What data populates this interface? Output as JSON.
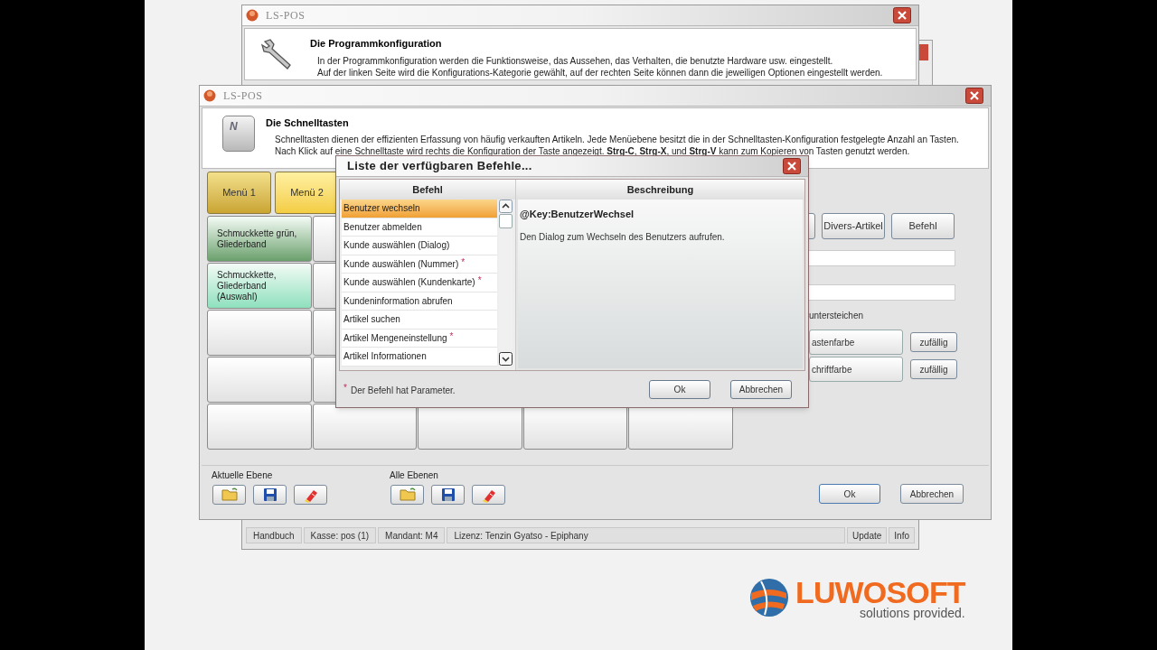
{
  "back_window": {
    "title": "LS-POS",
    "heading": "Die Programmkonfiguration",
    "description": [
      "In der Programmkonfiguration werden die Funktionsweise, das Aussehen, das Verhalten, die benutzte Hardware usw. eingestellt.",
      "Auf der linken Seite wird die Konfigurations-Kategorie gewählt, auf der rechten Seite können dann die jeweiligen Optionen eingestellt werden."
    ]
  },
  "status_bar": {
    "items": [
      "Handbuch",
      "Kasse: pos (1)",
      "Mandant: M4",
      "Lizenz: Tenzin Gyatso - Epiphany"
    ],
    "buttons": [
      "Update",
      "Info"
    ]
  },
  "main_window": {
    "title": "LS-POS",
    "key_letter": "N",
    "heading": "Die Schnelltasten",
    "description": [
      "Schnelltasten dienen der effizienten Erfassung von häufig verkauften Artikeln. Jede Menüebene besitzt die in der Schnelltasten-Konfiguration festgelegte Anzahl an Tasten.",
      "Nach Klick auf eine Schnelltaste wird rechts die Konfiguration der Taste angezeigt. **Strg-C**, **Strg-X**, und **Strg-V** kann zum Kopieren von Tasten genutzt werden."
    ],
    "menus": [
      {
        "label": "Menü 1",
        "selected": true
      },
      {
        "label": "Menü 2",
        "selected": false
      }
    ],
    "keys": [
      [
        {
          "kind": "article",
          "label": "Schmuckkette grün, Gliederband",
          "color": "#6aa06c"
        },
        {
          "kind": "empty"
        }
      ],
      [
        {
          "kind": "article",
          "label": "Schmuckkette, Gliederband (Auswahl)",
          "color": "#8ee0bd"
        },
        {
          "kind": "empty"
        }
      ],
      [
        {
          "kind": "empty"
        },
        {
          "kind": "empty"
        }
      ],
      [
        {
          "kind": "empty"
        },
        {
          "kind": "empty"
        }
      ],
      [
        {
          "kind": "empty"
        },
        {
          "kind": "empty"
        },
        {
          "kind": "empty"
        },
        {
          "kind": "empty"
        },
        {
          "kind": "empty"
        }
      ]
    ],
    "type_buttons": [
      "Divers-Artikel",
      "Befehl"
    ],
    "underline_label": "untersteichen",
    "color_rows": [
      {
        "label": "astenfarbe",
        "button": "zufällig"
      },
      {
        "label": "chriftfarbe",
        "button": "zufällig"
      }
    ],
    "level_groups": [
      {
        "label": "Aktuelle Ebene"
      },
      {
        "label": "Alle Ebenen"
      }
    ],
    "buttons": [
      "Ok",
      "Abbrechen"
    ]
  },
  "dialog": {
    "title": "Liste der verfügbaren  Befehle...",
    "columns": [
      "Befehl",
      "Beschreibung"
    ],
    "commands": [
      {
        "label": "Benutzer wechseln",
        "selected": true
      },
      {
        "label": "Benutzer abmelden",
        "selected": false
      },
      {
        "label": "Kunde auswählen (Dialog)",
        "selected": false
      },
      {
        "label": "Kunde auswählen (Nummer)",
        "marker": "*",
        "selected": false
      },
      {
        "label": "Kunde auswählen (Kundenkarte)",
        "marker": "*",
        "selected": false
      },
      {
        "label": "Kundeninformation abrufen",
        "selected": false
      },
      {
        "label": "Artikel suchen",
        "selected": false
      },
      {
        "label": "Artikel Mengeneinstellung",
        "marker": "*",
        "selected": false
      },
      {
        "label": "Artikel Informationen",
        "selected": false
      }
    ],
    "key": "@Key:BenutzerWechsel",
    "description": "Den Dialog zum Wechseln des Benutzers aufrufen.",
    "footnote_mark": "*",
    "footnote": "Der Befehl hat Parameter.",
    "buttons": [
      "Ok",
      "Abbrechen"
    ]
  },
  "logo": {
    "name": "LUWOSOFT",
    "tagline": "solutions provided."
  }
}
